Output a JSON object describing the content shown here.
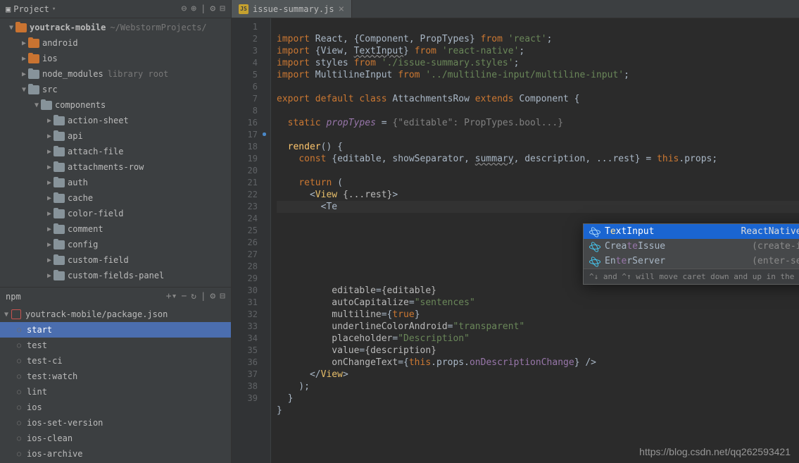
{
  "project": {
    "header_label": "Project",
    "root": "youtrack-mobile",
    "root_path": "~/WebstormProjects/"
  },
  "tree": [
    {
      "indent": 0,
      "arrow": "▼",
      "folder": "module",
      "label": "youtrack-mobile",
      "sublabel": "~/WebstormProjects/"
    },
    {
      "indent": 1,
      "arrow": "▶",
      "folder": "module",
      "label": "android"
    },
    {
      "indent": 1,
      "arrow": "▶",
      "folder": "module",
      "label": "ios"
    },
    {
      "indent": 1,
      "arrow": "▶",
      "folder": "dir",
      "label": "node_modules",
      "sublabel": "library root"
    },
    {
      "indent": 1,
      "arrow": "▼",
      "folder": "dir",
      "label": "src"
    },
    {
      "indent": 2,
      "arrow": "▼",
      "folder": "dir",
      "label": "components"
    },
    {
      "indent": 3,
      "arrow": "▶",
      "folder": "dir",
      "label": "action-sheet"
    },
    {
      "indent": 3,
      "arrow": "▶",
      "folder": "dir",
      "label": "api"
    },
    {
      "indent": 3,
      "arrow": "▶",
      "folder": "dir",
      "label": "attach-file"
    },
    {
      "indent": 3,
      "arrow": "▶",
      "folder": "dir",
      "label": "attachments-row"
    },
    {
      "indent": 3,
      "arrow": "▶",
      "folder": "dir",
      "label": "auth"
    },
    {
      "indent": 3,
      "arrow": "▶",
      "folder": "dir",
      "label": "cache"
    },
    {
      "indent": 3,
      "arrow": "▶",
      "folder": "dir",
      "label": "color-field"
    },
    {
      "indent": 3,
      "arrow": "▶",
      "folder": "dir",
      "label": "comment"
    },
    {
      "indent": 3,
      "arrow": "▶",
      "folder": "dir",
      "label": "config"
    },
    {
      "indent": 3,
      "arrow": "▶",
      "folder": "dir",
      "label": "custom-field"
    },
    {
      "indent": 3,
      "arrow": "▶",
      "folder": "dir",
      "label": "custom-fields-panel"
    }
  ],
  "npm": {
    "label": "npm",
    "pkg": "youtrack-mobile/package.json",
    "scripts": [
      "start",
      "test",
      "test-ci",
      "test:watch",
      "lint",
      "ios",
      "ios-set-version",
      "ios-clean",
      "ios-archive"
    ],
    "selected": 0
  },
  "tab": {
    "filename": "issue-summary.js"
  },
  "line_numbers": [
    "1",
    "2",
    "3",
    "4",
    "5",
    "6",
    "7",
    "8",
    "16",
    "17",
    "18",
    "19",
    "20",
    "21",
    "22",
    "23",
    "24",
    "25",
    "26",
    "27",
    "28",
    "29",
    "30",
    "31",
    "32",
    "33",
    "34",
    "35",
    "36",
    "37",
    "38",
    "39"
  ],
  "completion": {
    "items": [
      {
        "pre": "T",
        "hl": "e",
        "post": "xtInput",
        "hint": "ReactNative (react-native.js, react-native)",
        "selected": true
      },
      {
        "pre": "Crea",
        "hl": "te",
        "post": "Issue",
        "hint": "(create-issue.js, src/views/create-issue)"
      },
      {
        "pre": "En",
        "hl": "te",
        "post": "rServer",
        "hint": "(enter-server.js, src/views/enter-server)"
      }
    ],
    "footer": "^↓ and ^↑ will move caret down and up in the editor",
    "footer_link": ">>"
  },
  "code": {
    "l1_import": "import",
    "l1_react": "React",
    "l1_comp": "Component",
    "l1_pt": "PropTypes",
    "l1_from": "from",
    "l1_str": "'react'",
    "l2_view": "View",
    "l2_ti": "TextInput",
    "l2_str": "'react-native'",
    "l3_styles": "styles",
    "l3_str": "'./issue-summary.styles'",
    "l4_mi": "MultilineInput",
    "l4_str": "'../multiline-input/multiline-input'",
    "l6_export": "export default class",
    "l6_name": "AttachmentsRow",
    "l6_ext": "extends",
    "l6_comp": "Component",
    "l8_static": "static",
    "l8_pt": "propTypes",
    "l8_val": "{\"editable\": PropTypes.bool...}",
    "l17_render": "render",
    "l18_const": "const",
    "l18_d": "{editable, showSeparator, ",
    "l18_sum": "summary",
    "l18_d2": ", description, ...rest} = ",
    "l18_this": "this",
    "l18_props": ".props;",
    "l20_return": "return",
    "l21_view": "View",
    "l21_rest": "{...rest}",
    "l22_te": "<Te",
    "l28_e": "editable",
    "l28_v": "{editable}",
    "l29_a": "autoCapitalize",
    "l29_v": "\"sentences\"",
    "l30_m": "multiline",
    "l30_true": "true",
    "l31_u": "underlineColorAndroid",
    "l31_v": "\"transparent\"",
    "l32_p": "placeholder",
    "l32_v": "\"Description\"",
    "l33_v": "value",
    "l33_d": "{description}",
    "l34_o": "onChangeText",
    "l34_this": "this",
    "l34_props": ".props.",
    "l34_fn": "onDescriptionChange",
    "l35_view": "View"
  },
  "watermark": "https://blog.csdn.net/qq262593421"
}
